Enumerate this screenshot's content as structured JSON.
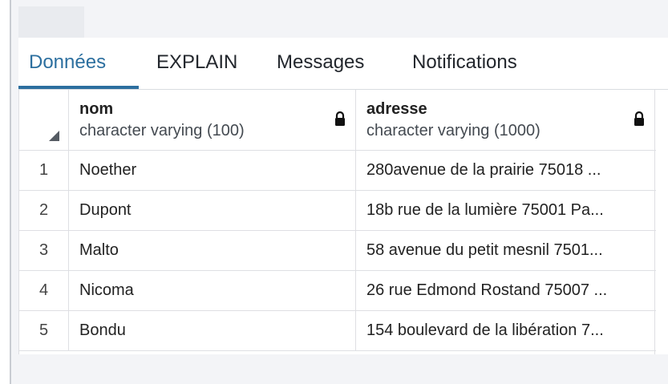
{
  "tabs": [
    {
      "label": "Données",
      "active": true
    },
    {
      "label": "EXPLAIN",
      "active": false
    },
    {
      "label": "Messages",
      "active": false
    },
    {
      "label": "Notifications",
      "active": false
    }
  ],
  "table": {
    "columns": [
      {
        "name": "nom",
        "type": "character varying (100)",
        "locked": true
      },
      {
        "name": "adresse",
        "type": "character varying (1000)",
        "locked": true
      }
    ],
    "rows": [
      {
        "num": "1",
        "nom": "Noether",
        "adresse": "280avenue de la prairie 75018 ..."
      },
      {
        "num": "2",
        "nom": "Dupont",
        "adresse": "18b rue de la lumière 75001 Pa..."
      },
      {
        "num": "3",
        "nom": "Malto",
        "adresse": "58 avenue du petit mesnil 7501..."
      },
      {
        "num": "4",
        "nom": "Nicoma",
        "adresse": "26 rue Edmond Rostand 75007 ..."
      },
      {
        "num": "5",
        "nom": "Bondu",
        "adresse": "154 boulevard de la libération 7..."
      }
    ]
  },
  "colors": {
    "accent": "#2c6f9f",
    "border": "#dedfe3",
    "background": "#f3f4f7"
  },
  "icons": {
    "lock": "lock-icon",
    "sort_corner": "select-all-triangle-icon"
  }
}
